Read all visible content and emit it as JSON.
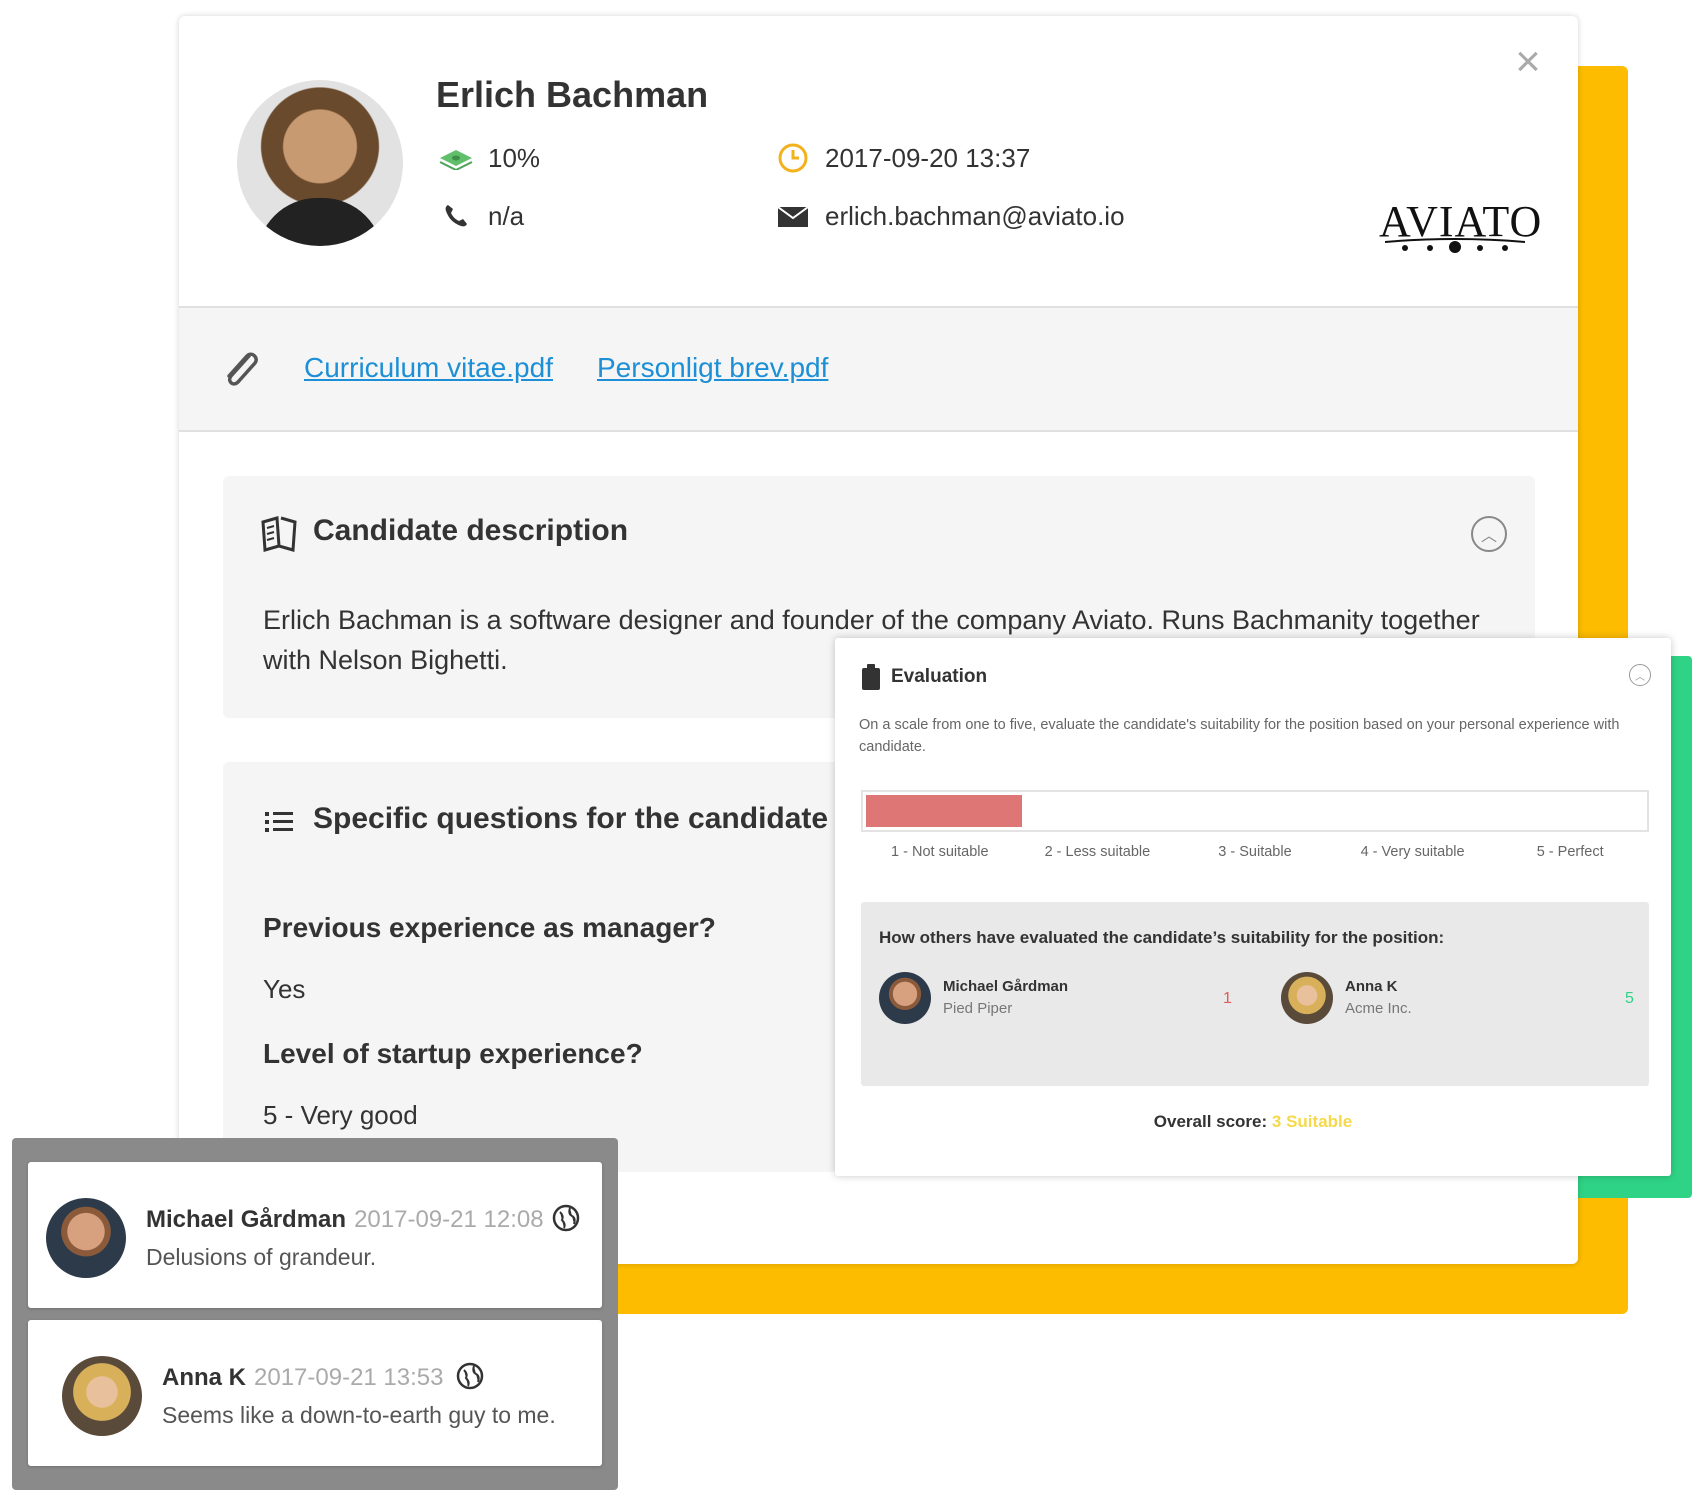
{
  "candidate": {
    "name": "Erlich Bachman",
    "percentage": "10%",
    "phone": "n/a",
    "datetime": "2017-09-20 13:37",
    "email": "erlich.bachman@aviato.io",
    "company_logo": "AVIATO"
  },
  "attachments": [
    "Curriculum vitae.pdf",
    "Personligt brev.pdf"
  ],
  "description": {
    "title": "Candidate description",
    "text": "Erlich Bachman is a software designer and founder of the company Aviato. Runs Bachmanity together with Nelson Bighetti."
  },
  "questions": {
    "title": "Specific questions for the candidate",
    "items": [
      {
        "q": "Previous experience as manager?",
        "a": "Yes"
      },
      {
        "q": "Level of startup experience?",
        "a": "5 - Very good"
      }
    ]
  },
  "evaluation": {
    "title": "Evaluation",
    "description": "On a scale from one to five, evaluate the candidate's suitability for the position based on your personal experience with candidate.",
    "selected_rating": 1,
    "rating_labels": [
      "1 - Not suitable",
      "2 - Less suitable",
      "3 - Suitable",
      "4 - Very suitable",
      "5 - Perfect"
    ],
    "others_title": "How others have evaluated the candidate’s suitability for the position:",
    "others": [
      {
        "name": "Michael Gårdman",
        "company": "Pied Piper",
        "score": "1",
        "color": "#e05a5a"
      },
      {
        "name": "Anna K",
        "company": "Acme Inc.",
        "score": "5",
        "color": "#2fd385"
      }
    ],
    "overall_label": "Overall score:",
    "overall_value": "3 Suitable"
  },
  "comments": [
    {
      "name": "Michael Gårdman",
      "timestamp": "2017-09-21 12:08",
      "text": "Delusions of grandeur."
    },
    {
      "name": "Anna K",
      "timestamp": "2017-09-21 13:53",
      "text": "Seems like a down-to-earth guy to me."
    }
  ],
  "colors": {
    "accent_yellow": "#fdbc00",
    "accent_green": "#2fd385",
    "link": "#1c8fd6",
    "rating_fill": "#df7676"
  },
  "icons": [
    "close-icon",
    "money-icon",
    "phone-icon",
    "clock-icon",
    "mail-icon",
    "paperclip-icon",
    "book-icon",
    "list-icon",
    "clipboard-icon",
    "chevron-up-icon",
    "globe-icon"
  ]
}
